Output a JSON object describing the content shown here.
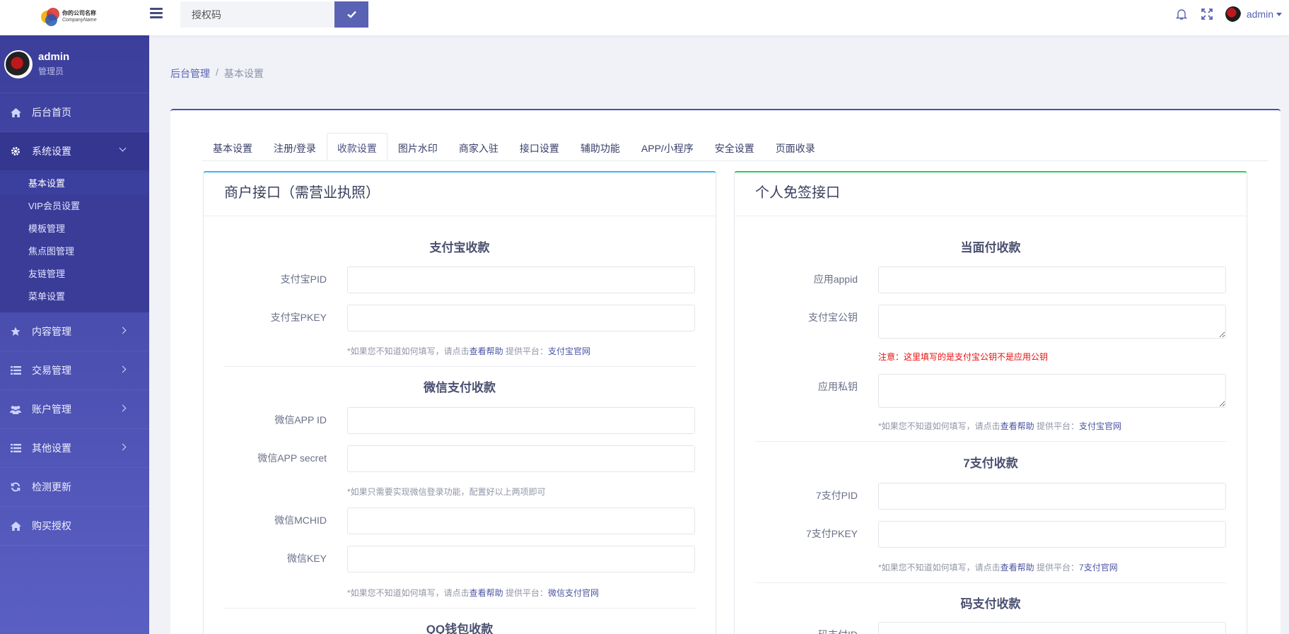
{
  "header": {
    "logo": {
      "line1": "你的公司名称",
      "line2": "CompanyName"
    },
    "auth_placeholder": "授权码",
    "user_name": "admin"
  },
  "sidebar": {
    "user": {
      "name": "admin",
      "role": "管理员"
    },
    "items": [
      {
        "label": "后台首页",
        "icon": "home-icon"
      },
      {
        "label": "系统设置",
        "icon": "gear-icon",
        "open": true,
        "children": [
          "基本设置",
          "VIP会员设置",
          "模板管理",
          "焦点图管理",
          "友链管理",
          "菜单设置"
        ]
      },
      {
        "label": "内容管理",
        "icon": "star-icon"
      },
      {
        "label": "交易管理",
        "icon": "list-icon"
      },
      {
        "label": "账户管理",
        "icon": "users-icon"
      },
      {
        "label": "其他设置",
        "icon": "list-icon"
      },
      {
        "label": "检测更新",
        "icon": "refresh-icon"
      },
      {
        "label": "购买授权",
        "icon": "home-icon"
      }
    ]
  },
  "breadcrumb": {
    "root": "后台管理",
    "current": "基本设置"
  },
  "tabs": [
    "基本设置",
    "注册/登录",
    "收款设置",
    "图片水印",
    "商家入驻",
    "接口设置",
    "辅助功能",
    "APP/小程序",
    "安全设置",
    "页面收录"
  ],
  "active_tab": "收款设置",
  "left_panel": {
    "title": "商户接口（需营业执照）",
    "alipay": {
      "title": "支付宝收款",
      "pid_label": "支付宝PID",
      "pkey_label": "支付宝PKEY",
      "hint_text": "*如果您不知道如何填写，请点击",
      "help_link": "查看帮助",
      "platform_text": " 提供平台：",
      "platform_link": "支付宝官网"
    },
    "wechat": {
      "title": "微信支付收款",
      "appid_label": "微信APP ID",
      "secret_label": "微信APP secret",
      "login_hint": "*如果只需要实现微信登录功能，配置好以上两项即可",
      "mchid_label": "微信MCHID",
      "key_label": "微信KEY",
      "hint_text": "*如果您不知道如何填写，请点击",
      "help_link": "查看帮助",
      "platform_text": " 提供平台：",
      "platform_link": "微信支付官网"
    },
    "qq": {
      "title": "QQ钱包收款"
    }
  },
  "right_panel": {
    "title": "个人免签接口",
    "f2f": {
      "title": "当面付收款",
      "appid_label": "应用appid",
      "pubkey_label": "支付宝公钥",
      "warn": "注意：这里填写的是支付宝公钥不是应用公钥",
      "privkey_label": "应用私钥",
      "hint_text": "*如果您不知道如何填写，请点击",
      "help_link": "查看帮助",
      "platform_text": " 提供平台：",
      "platform_link": "支付宝官网"
    },
    "pay7": {
      "title": "7支付收款",
      "pid_label": "7支付PID",
      "pkey_label": "7支付PKEY",
      "hint_text": "*如果您不知道如何填写，请点击",
      "help_link": "查看帮助",
      "platform_text": " 提供平台：",
      "platform_link": "7支付官网"
    },
    "codepay": {
      "title": "码支付收款",
      "id_label": "码支付ID"
    }
  },
  "colors": {
    "sidebar_top": "#3c3e9b",
    "sidebar_bottom": "#5a5fc3",
    "accent": "#5a62b3",
    "left_border": "#3fb5ef",
    "right_border": "#35c75e",
    "warn": "#e60f0f"
  }
}
